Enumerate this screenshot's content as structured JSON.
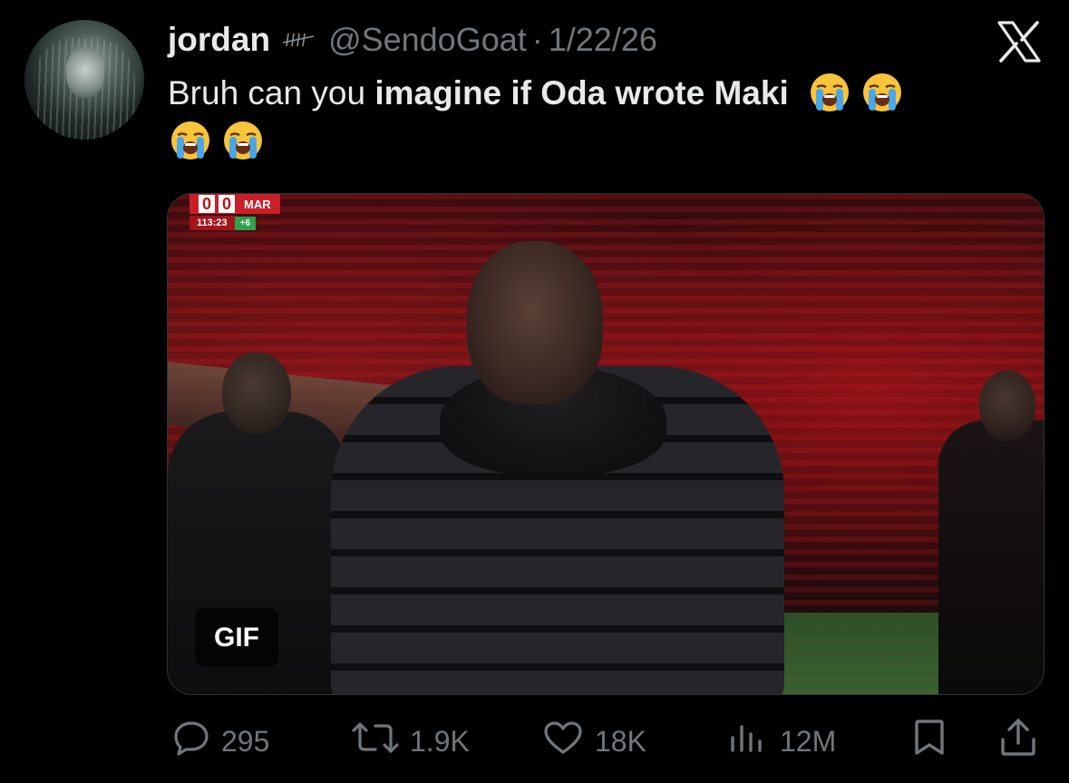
{
  "tweet": {
    "author": {
      "display_name": "jordan",
      "badge_icon": "tally-marks-icon",
      "handle": "@SendoGoat",
      "separator": "·",
      "date": "1/22/26"
    },
    "text": {
      "part1": "Bruh can you ",
      "bold": "imagine if Oda wrote Maki"
    },
    "emojis": [
      "loudly-crying-face-icon",
      "loudly-crying-face-icon",
      "loudly-crying-face-icon",
      "loudly-crying-face-icon"
    ],
    "media": {
      "type_badge": "GIF",
      "scoreboard": {
        "home_score": "0",
        "away_score": "0",
        "team": "MAR",
        "clock": "113:23",
        "added_time": "+6"
      }
    },
    "actions": {
      "replies": "295",
      "reposts": "1.9K",
      "likes": "18K",
      "views": "12M"
    }
  },
  "colors": {
    "background": "#000000",
    "primary_text": "#e7e9ea",
    "secondary_text": "#71767b"
  }
}
